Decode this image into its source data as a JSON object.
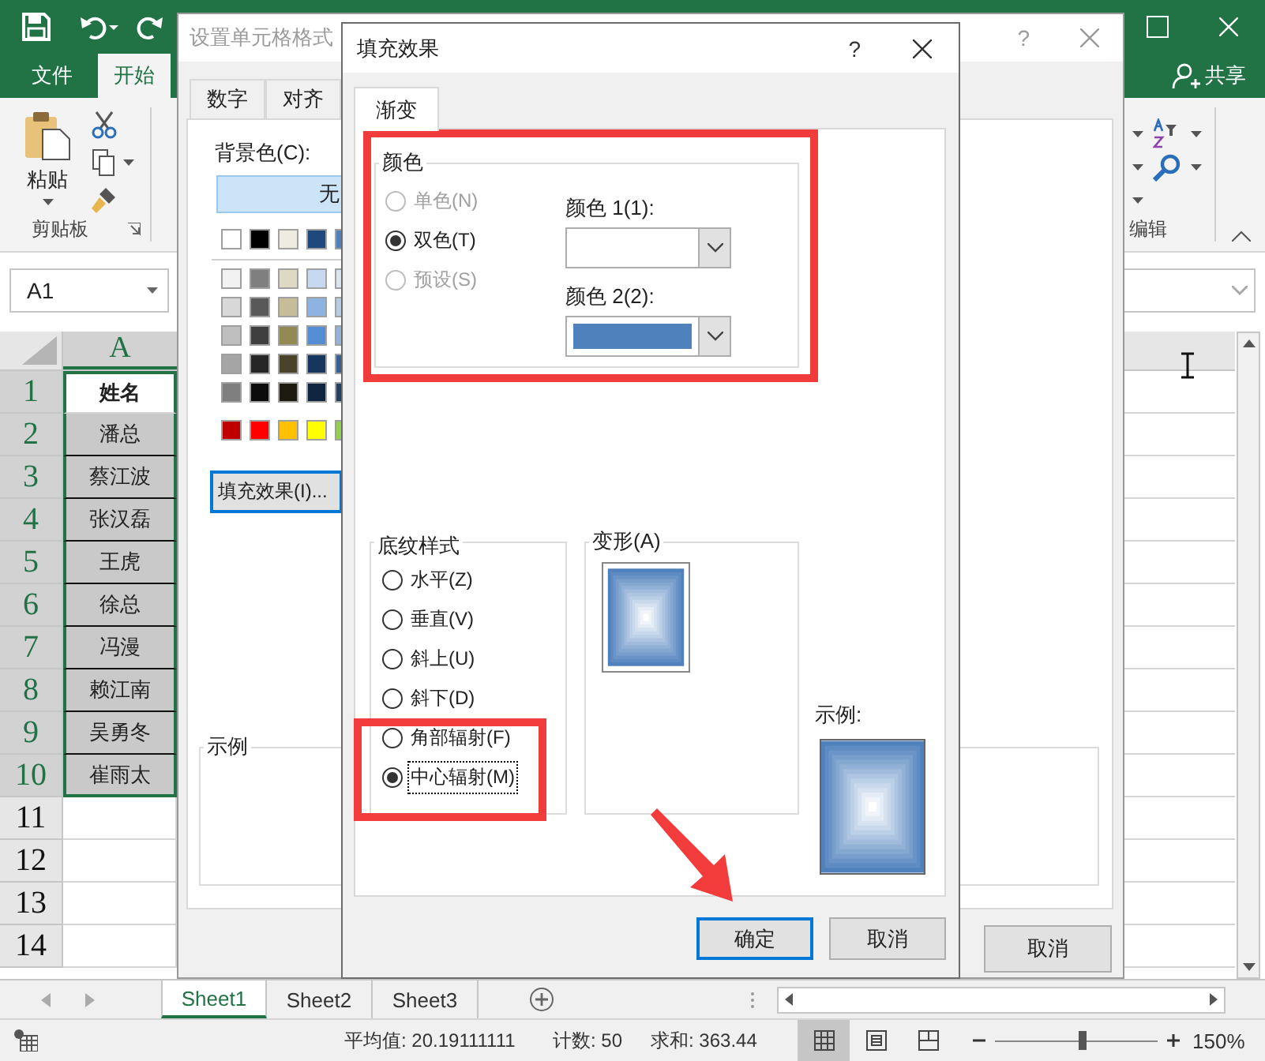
{
  "excel": {
    "ribbon_tabs": [
      {
        "label": "文件",
        "selected": false
      },
      {
        "label": "开始",
        "selected": true
      }
    ],
    "share_button": "共享",
    "paste_button": "粘贴",
    "clipboard_group": "剪贴板",
    "editing_group": "编辑",
    "name_box": "A1",
    "column_header": "A",
    "row_numbers": [
      "1",
      "2",
      "3",
      "4",
      "5",
      "6",
      "7",
      "8",
      "9",
      "10",
      "11",
      "12",
      "13",
      "14"
    ],
    "cells": [
      {
        "text": "姓名",
        "kind": "header",
        "selected": true
      },
      {
        "text": "潘总",
        "kind": "name",
        "selected": true
      },
      {
        "text": "蔡江波",
        "kind": "name",
        "selected": true
      },
      {
        "text": "张汉磊",
        "kind": "name",
        "selected": true
      },
      {
        "text": "王虎",
        "kind": "name",
        "selected": true
      },
      {
        "text": "徐总",
        "kind": "name",
        "selected": true
      },
      {
        "text": "冯漫",
        "kind": "name",
        "selected": true
      },
      {
        "text": "赖江南",
        "kind": "name",
        "selected": true
      },
      {
        "text": "吴勇冬",
        "kind": "name",
        "selected": true
      },
      {
        "text": "崔雨太",
        "kind": "name",
        "selected": true
      }
    ],
    "sheet_tabs": [
      {
        "label": "Sheet1",
        "selected": true
      },
      {
        "label": "Sheet2",
        "selected": false
      },
      {
        "label": "Sheet3",
        "selected": false
      }
    ],
    "status_bar": {
      "average": "平均值: 20.19111111",
      "count": "计数: 50",
      "sum": "求和: 363.44",
      "view_buttons": [
        {
          "selected": true
        },
        {
          "selected": false
        },
        {
          "selected": false
        }
      ],
      "zoom_slider": {
        "level": 0.53
      },
      "zoom": "150%"
    }
  },
  "format_dialog": {
    "title": "设置单元格格式",
    "help": "?",
    "tabs": [
      {
        "label": "数字",
        "selected": false
      },
      {
        "label": "对齐",
        "selected": false
      }
    ],
    "background_label": "背景色(C):",
    "no_color_button": "无",
    "theme_colors": [
      {
        "color": "#ffffff"
      },
      {
        "color": "#000000"
      },
      {
        "color": "#eeece1"
      },
      {
        "color": "#1f497d"
      },
      {
        "color": "#4f81bd"
      }
    ],
    "shade_rows": [
      [
        {
          "color": "#f2f2f2"
        },
        {
          "color": "#7f7f7f"
        },
        {
          "color": "#ddd9c3"
        },
        {
          "color": "#c6d9f0"
        },
        {
          "color": "#dbe5f1"
        }
      ],
      [
        {
          "color": "#d8d8d8"
        },
        {
          "color": "#595959"
        },
        {
          "color": "#c4bd97"
        },
        {
          "color": "#8db3e2"
        },
        {
          "color": "#b8cce4"
        }
      ],
      [
        {
          "color": "#bfbfbf"
        },
        {
          "color": "#3f3f3f"
        },
        {
          "color": "#938953"
        },
        {
          "color": "#548dd4"
        },
        {
          "color": "#95b3d7"
        }
      ],
      [
        {
          "color": "#a5a5a5"
        },
        {
          "color": "#262626"
        },
        {
          "color": "#494429"
        },
        {
          "color": "#17365d"
        },
        {
          "color": "#366092"
        }
      ],
      [
        {
          "color": "#7f7f7f"
        },
        {
          "color": "#0c0c0c"
        },
        {
          "color": "#1d1b10"
        },
        {
          "color": "#0f243e"
        },
        {
          "color": "#244061"
        }
      ]
    ],
    "standard_colors": [
      {
        "color": "#c00000"
      },
      {
        "color": "#ff0000"
      },
      {
        "color": "#ffc000"
      },
      {
        "color": "#ffff00"
      },
      {
        "color": "#92d050"
      }
    ],
    "fill_effects_button": "填充效果(I)...",
    "sample_label": "示例",
    "cancel_button": "取消"
  },
  "fill_dialog": {
    "title": "填充效果",
    "help": "?",
    "tabs": [
      {
        "label": "渐变",
        "selected": true
      }
    ],
    "colors_group": {
      "title": "颜色",
      "options": [
        {
          "label": "单色(N)",
          "selected": false,
          "disabled": true
        },
        {
          "label": "双色(T)",
          "selected": true,
          "disabled": false
        },
        {
          "label": "预设(S)",
          "selected": false,
          "disabled": true
        }
      ],
      "color1_label": "颜色 1(1):",
      "color1": {
        "color": "#ffffff"
      },
      "color2_label": "颜色 2(2):",
      "color2": {
        "color": "#4f81bd"
      }
    },
    "shading_group": {
      "title": "底纹样式",
      "options": [
        {
          "label": "水平(Z)",
          "selected": false
        },
        {
          "label": "垂直(V)",
          "selected": false
        },
        {
          "label": "斜上(U)",
          "selected": false
        },
        {
          "label": "斜下(D)",
          "selected": false
        },
        {
          "label": "角部辐射(F)",
          "selected": false
        },
        {
          "label": "中心辐射(M)",
          "selected": true
        }
      ]
    },
    "variants_group": {
      "title": "变形(A)",
      "variants": [
        {
          "selected": true
        }
      ]
    },
    "sample_label": "示例:",
    "ok_button": "确定",
    "cancel_button": "取消"
  }
}
